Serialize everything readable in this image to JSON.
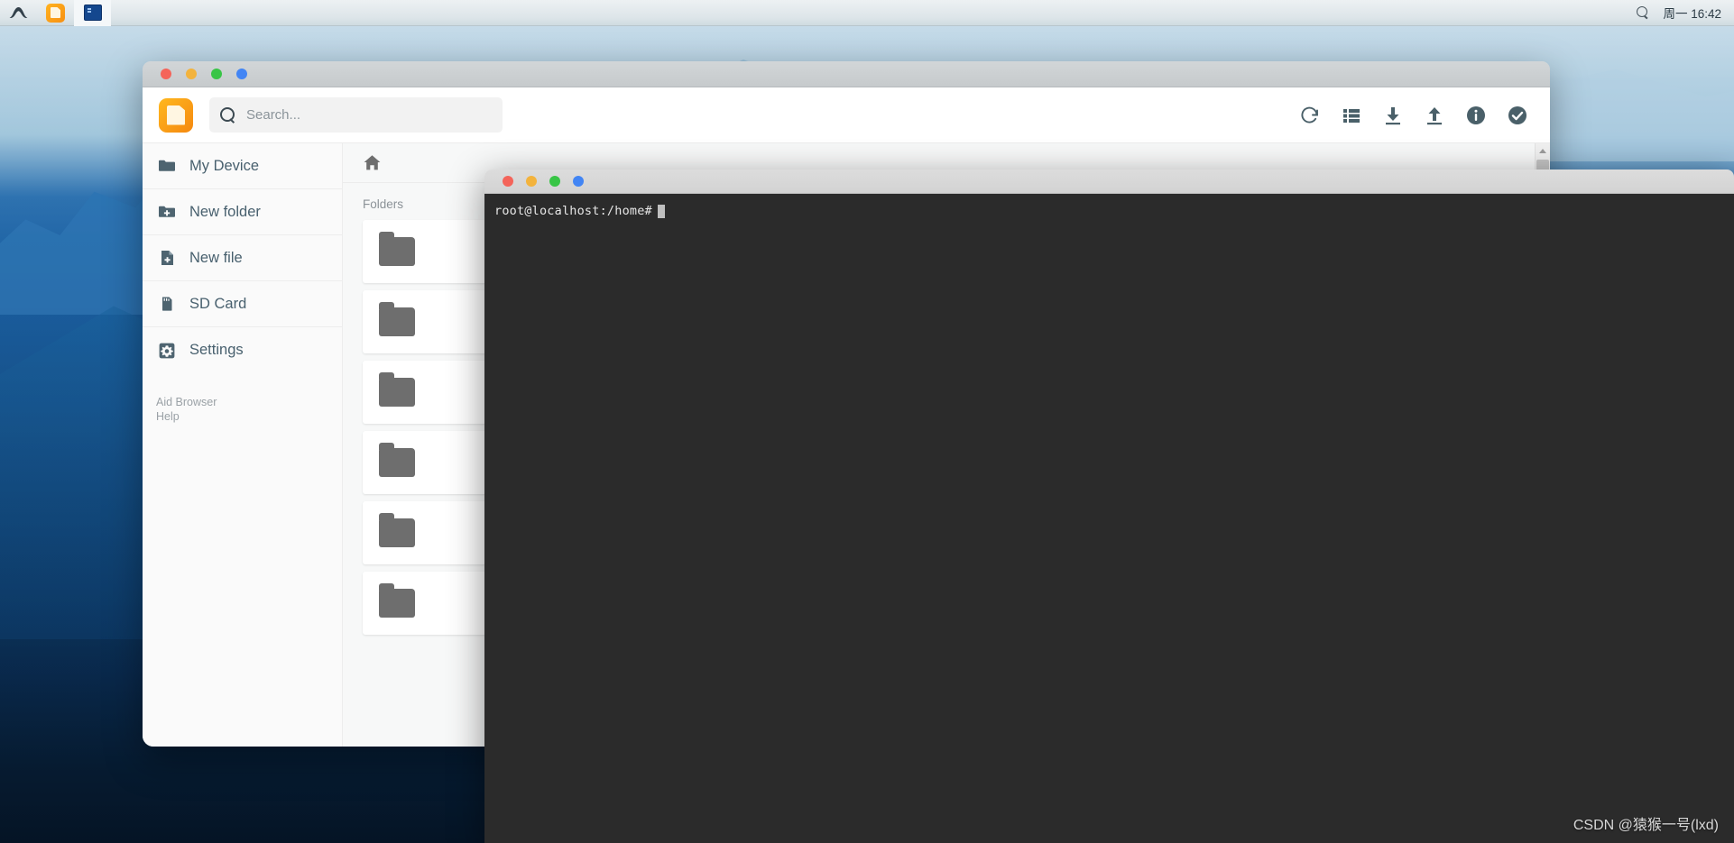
{
  "topbar": {
    "apps": [
      {
        "name": "system-logo",
        "icon": "mountain-logo-icon",
        "label": ""
      },
      {
        "name": "file-manager",
        "icon": "file-manager-icon",
        "label": ""
      },
      {
        "name": "terminal",
        "icon": "terminal-icon",
        "label": ""
      }
    ],
    "search_icon": "search-icon",
    "clock": "周一  16:42"
  },
  "file_manager": {
    "window_controls": [
      "close",
      "minimize",
      "maximize",
      "more"
    ],
    "app_icon": "file-manager-icon",
    "search": {
      "placeholder": "Search...",
      "value": "",
      "icon": "search-icon"
    },
    "toolbar_icons": [
      {
        "name": "refresh-icon",
        "title": "Refresh"
      },
      {
        "name": "list-view-icon",
        "title": "List view"
      },
      {
        "name": "download-icon",
        "title": "Download"
      },
      {
        "name": "upload-icon",
        "title": "Upload"
      },
      {
        "name": "info-icon",
        "title": "Info"
      },
      {
        "name": "select-check-icon",
        "title": "Select"
      }
    ],
    "sidebar": {
      "items": [
        {
          "label": "My Device",
          "icon": "folder-icon"
        },
        {
          "label": "New folder",
          "icon": "folder-plus-icon"
        },
        {
          "label": "New file",
          "icon": "file-plus-icon"
        },
        {
          "label": "SD Card",
          "icon": "sd-card-icon"
        },
        {
          "label": "Settings",
          "icon": "settings-gear-icon"
        }
      ],
      "footer": [
        {
          "label": "Aid Browser"
        },
        {
          "label": "Help"
        }
      ]
    },
    "content": {
      "home_icon": "home-icon",
      "section_label": "Folders",
      "folder_cards": [
        {
          "icon": "folder-icon",
          "label": ""
        },
        {
          "icon": "folder-icon",
          "label": ""
        },
        {
          "icon": "folder-icon",
          "label": ""
        },
        {
          "icon": "folder-icon",
          "label": ""
        },
        {
          "icon": "folder-icon",
          "label": ""
        },
        {
          "icon": "folder-icon",
          "label": ""
        }
      ]
    },
    "scrollbar": {
      "arrow": "chevron-up-icon"
    }
  },
  "terminal": {
    "window_controls": [
      "close",
      "minimize",
      "maximize",
      "more"
    ],
    "prompt": "root@localhost:/home#",
    "cursor": "block"
  },
  "watermark": "CSDN @猿猴一号(lxd)",
  "colors": {
    "accent_orange": "#f5880f",
    "window_chrome": "#d2d6d8",
    "terminal_bg": "#2b2b2b",
    "sidebar_text": "#48606e",
    "dot_red": "#f4645a",
    "dot_yellow": "#f3b33d",
    "dot_green": "#38c546",
    "dot_blue": "#4285f4"
  }
}
